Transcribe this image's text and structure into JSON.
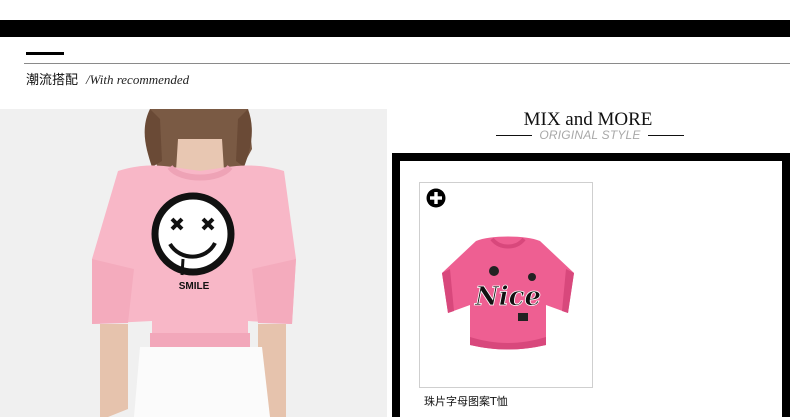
{
  "header": {
    "title_zh": "潮流搭配",
    "title_en": "/With recommended"
  },
  "model_photo": {
    "shirt_text": "SMILE",
    "shirt_color": "#f8b7c7"
  },
  "collection": {
    "title": "MIX and MORE",
    "subtitle": "ORIGINAL STYLE"
  },
  "products": [
    {
      "name": "珠片字母图案T恤",
      "graphic_text": "Nice",
      "color": "#ee5f92",
      "action_icon": "plus-circle-icon"
    }
  ]
}
